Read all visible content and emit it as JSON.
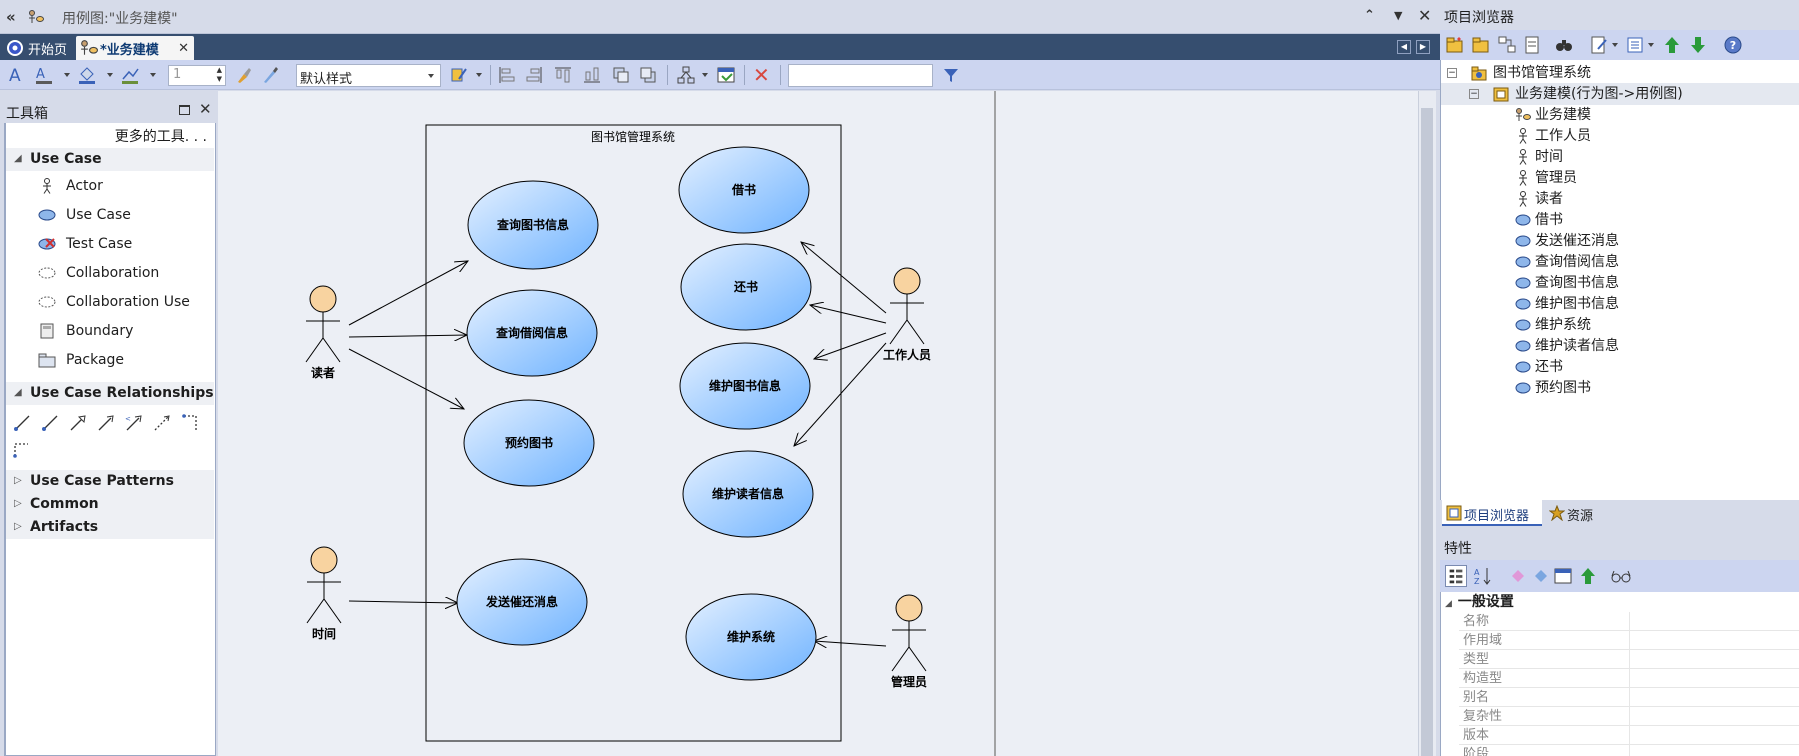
{
  "window": {
    "title": "用例图:\"业务建模\""
  },
  "tabs": [
    {
      "label": "开始页"
    },
    {
      "label": "*业务建模"
    }
  ],
  "toolbar": {
    "line_width": "1",
    "style_select": "默认样式",
    "search_value": ""
  },
  "toolbox": {
    "title": "工具箱",
    "more_tools": "更多的工具. . .",
    "sections": {
      "use_case": "Use Case",
      "relationships": "Use Case Relationships",
      "patterns": "Use Case Patterns",
      "common": "Common",
      "artifacts": "Artifacts"
    },
    "items": [
      "Actor",
      "Use Case",
      "Test Case",
      "Collaboration",
      "Collaboration Use",
      "Boundary",
      "Package"
    ]
  },
  "diagram": {
    "boundary_label": "图书馆管理系统",
    "actors": [
      "读者",
      "时间",
      "工作人员",
      "管理员"
    ],
    "usecases": [
      "查询图书信息",
      "查询借阅信息",
      "预约图书",
      "发送催还消息",
      "借书",
      "还书",
      "维护图书信息",
      "维护读者信息",
      "维护系统"
    ]
  },
  "project_browser": {
    "title": "项目浏览器",
    "root": "图书馆管理系统",
    "package": "业务建模(行为图->用例图)",
    "items": [
      "业务建模",
      "工作人员",
      "时间",
      "管理员",
      "读者",
      "借书",
      "发送催还消息",
      "查询借阅信息",
      "查询图书信息",
      "维护图书信息",
      "维护系统",
      "维护读者信息",
      "还书",
      "预约图书"
    ],
    "tabs": [
      "项目浏览器",
      "资源"
    ]
  },
  "properties": {
    "title": "特性",
    "group": "一般设置",
    "rows": [
      "名称",
      "作用域",
      "类型",
      "构造型",
      "别名",
      "复杂性",
      "版本",
      "阶段"
    ]
  },
  "colors": {
    "tab_bar": "#364e6f",
    "toolbar": "#ccd5f0",
    "usecase_fill_light": "#e4f0ff",
    "usecase_fill_dark": "#6fb3ff",
    "actor_head": "#f8d3a0"
  }
}
